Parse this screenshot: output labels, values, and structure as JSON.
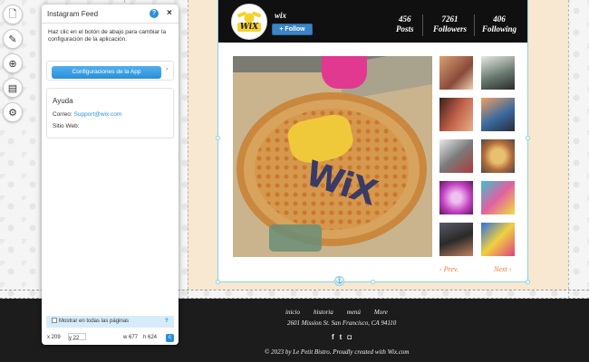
{
  "panel": {
    "title": "Instagram Feed",
    "help_icon": "?",
    "close_icon": "×",
    "description": "Haz clic en el botón de abajo para cambiar la configuración de la aplicación.",
    "app_button": "Configuraciones de la App",
    "app_button_arrow": "›",
    "help_title": "Ayuda",
    "email_label": "Correo:",
    "email_value": "Support@wix.com",
    "website_label": "Sitio Web:",
    "show_all_label": "Mostrar en todas las páginas",
    "show_all_help": "?",
    "x_label": "x 209",
    "y_label": "y 22",
    "w_label": "w 677",
    "h_label": "h 624",
    "corner_icon": "c"
  },
  "toolbar": {
    "icons": [
      "page-icon",
      "brush-icon",
      "add-icon",
      "store-icon",
      "settings-icon"
    ],
    "glyphs": [
      "🗋",
      "✎",
      "⊕",
      "▤",
      "⚙"
    ]
  },
  "instagram": {
    "logo_text": "WiX",
    "username": "wix",
    "follow_button": "+ Follow",
    "stats": [
      {
        "value": "456",
        "label": "Posts"
      },
      {
        "value": "7261",
        "label": "Followers"
      },
      {
        "value": "406",
        "label": "Following"
      }
    ],
    "prev_link": "‹ Prev.",
    "next_link": "Next ›",
    "main_photo_text": "WiX",
    "anchor_icon": "⚓"
  },
  "footer": {
    "nav": [
      "inicio",
      "historia",
      "menú",
      "More"
    ],
    "address": "2601 Mission St. San Francisco, CA 94110",
    "social": [
      "f",
      "t",
      "◘"
    ],
    "copyright": "© 2023 by Le Petit Bistro. Proudly created with Wix.com"
  },
  "colors": {
    "accent_blue": "#2b8fd8",
    "link_orange": "#e9773d",
    "footer_bg": "#1c1c1c",
    "header_bg": "#101010",
    "page_bg": "#f8e7d1"
  }
}
